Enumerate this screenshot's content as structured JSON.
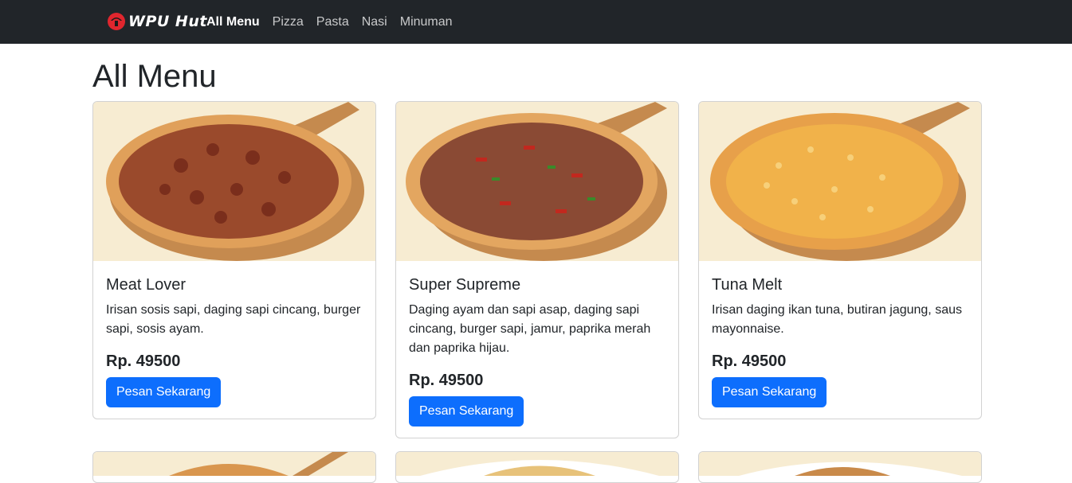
{
  "navbar": {
    "brand": "WPU Hut",
    "links": [
      {
        "label": "All Menu",
        "active": true
      },
      {
        "label": "Pizza",
        "active": false
      },
      {
        "label": "Pasta",
        "active": false
      },
      {
        "label": "Nasi",
        "active": false
      },
      {
        "label": "Minuman",
        "active": false
      }
    ]
  },
  "main": {
    "title": "All Menu",
    "cards": [
      {
        "name": "Meat Lover",
        "description": "Irisan sosis sapi, daging sapi cincang, burger sapi, sosis ayam.",
        "price": "Rp. 49500",
        "button": "Pesan Sekarang"
      },
      {
        "name": "Super Supreme",
        "description": "Daging ayam dan sapi asap, daging sapi cincang, burger sapi, jamur, paprika merah dan paprika hijau.",
        "price": "Rp. 49500",
        "button": "Pesan Sekarang"
      },
      {
        "name": "Tuna Melt",
        "description": "Irisan daging ikan tuna, butiran jagung, saus mayonnaise.",
        "price": "Rp. 49500",
        "button": "Pesan Sekarang"
      }
    ]
  },
  "colors": {
    "navbar_bg": "#212529",
    "primary": "#0d6efd",
    "logo_red": "#e0262e"
  }
}
